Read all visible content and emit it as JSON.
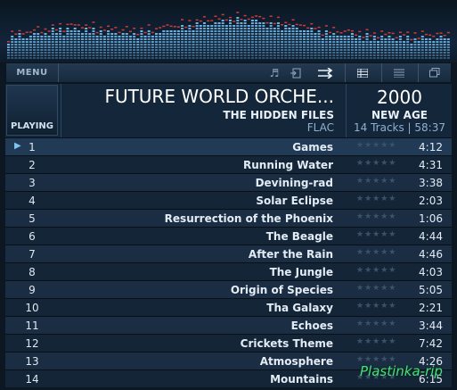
{
  "toolbar": {
    "menu_label": "MENU",
    "icons": [
      "music-note-icon",
      "import-icon",
      "shuffle-arrows-icon",
      "grid-view-icon",
      "list-view-icon",
      "restore-window-icon"
    ]
  },
  "now_playing": {
    "status_label": "PLAYING",
    "album": "FUTURE WORLD ORCHE...",
    "artist": "THE HIDDEN FILES",
    "format": "FLAC",
    "year": "2000",
    "genre": "NEW AGE",
    "summary": "14 Tracks | 58:37"
  },
  "tracks": [
    {
      "num": "1",
      "title": "Games",
      "duration": "4:12",
      "playing": true
    },
    {
      "num": "2",
      "title": "Running Water",
      "duration": "4:31"
    },
    {
      "num": "3",
      "title": "Devining-rad",
      "duration": "3:38"
    },
    {
      "num": "4",
      "title": "Solar Eclipse",
      "duration": "2:03"
    },
    {
      "num": "5",
      "title": "Resurrection of the Phoenix",
      "duration": "1:06"
    },
    {
      "num": "6",
      "title": "The Beagle",
      "duration": "4:44"
    },
    {
      "num": "7",
      "title": "After the Rain",
      "duration": "4:46"
    },
    {
      "num": "8",
      "title": "The Jungle",
      "duration": "4:03"
    },
    {
      "num": "9",
      "title": "Origin of Species",
      "duration": "5:05"
    },
    {
      "num": "10",
      "title": "Tha Galaxy",
      "duration": "2:21"
    },
    {
      "num": "11",
      "title": "Echoes",
      "duration": "3:44"
    },
    {
      "num": "12",
      "title": "Crickets Theme",
      "duration": "7:42"
    },
    {
      "num": "13",
      "title": "Atmosphere",
      "duration": "4:26"
    },
    {
      "num": "14",
      "title": "Mountains",
      "duration": "6:15"
    }
  ],
  "watermark": "Plastinka-rip",
  "colors": {
    "accent": "#7fc3f0",
    "visualizer_bar": "#6fb6e6",
    "visualizer_peak": "#d23a3a",
    "watermark": "#45e07a"
  }
}
